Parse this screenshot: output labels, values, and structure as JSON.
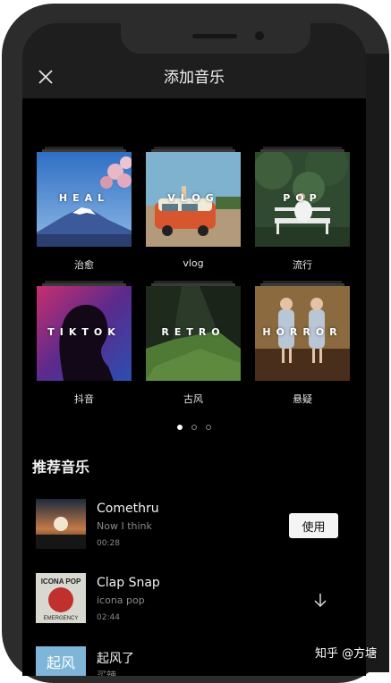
{
  "header": {
    "title": "添加音乐"
  },
  "categories": [
    {
      "tag": "HEAL",
      "label": "治愈"
    },
    {
      "tag": "VLOG",
      "label": "vlog"
    },
    {
      "tag": "POP",
      "label": "流行"
    },
    {
      "tag": "TIKTOK",
      "label": "抖音"
    },
    {
      "tag": "RETRO",
      "label": "古风"
    },
    {
      "tag": "HORROR",
      "label": "悬疑"
    }
  ],
  "pagination": {
    "current": 1,
    "total": 3
  },
  "recommended": {
    "title": "推荐音乐",
    "tracks": [
      {
        "name": "Comethru",
        "artist": "Now I think",
        "duration": "00:28",
        "action": "使用"
      },
      {
        "name": "Clap Snap",
        "artist": "icona pop",
        "duration": "02:44",
        "action": "download-icon"
      },
      {
        "name": "起风了",
        "artist": "买辣",
        "duration": "",
        "action": ""
      }
    ],
    "album_text": {
      "clap_snap_top": "ICONA POP",
      "clap_snap_bottom": "EMERGENCY",
      "qifengle": "起风"
    }
  },
  "watermark": "知乎 @方塘",
  "colors": {
    "accent_button": "#f4f4f4",
    "background": "#000000",
    "navbar": "#1e1e1e"
  }
}
